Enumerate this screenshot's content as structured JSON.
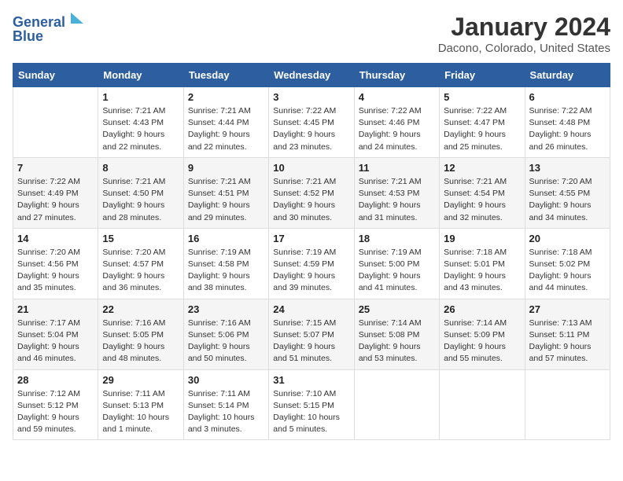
{
  "logo": {
    "line1": "General",
    "line2": "Blue"
  },
  "title": "January 2024",
  "subtitle": "Dacono, Colorado, United States",
  "days_of_week": [
    "Sunday",
    "Monday",
    "Tuesday",
    "Wednesday",
    "Thursday",
    "Friday",
    "Saturday"
  ],
  "weeks": [
    [
      {
        "day": "",
        "info": ""
      },
      {
        "day": "1",
        "info": "Sunrise: 7:21 AM\nSunset: 4:43 PM\nDaylight: 9 hours\nand 22 minutes."
      },
      {
        "day": "2",
        "info": "Sunrise: 7:21 AM\nSunset: 4:44 PM\nDaylight: 9 hours\nand 22 minutes."
      },
      {
        "day": "3",
        "info": "Sunrise: 7:22 AM\nSunset: 4:45 PM\nDaylight: 9 hours\nand 23 minutes."
      },
      {
        "day": "4",
        "info": "Sunrise: 7:22 AM\nSunset: 4:46 PM\nDaylight: 9 hours\nand 24 minutes."
      },
      {
        "day": "5",
        "info": "Sunrise: 7:22 AM\nSunset: 4:47 PM\nDaylight: 9 hours\nand 25 minutes."
      },
      {
        "day": "6",
        "info": "Sunrise: 7:22 AM\nSunset: 4:48 PM\nDaylight: 9 hours\nand 26 minutes."
      }
    ],
    [
      {
        "day": "7",
        "info": "Sunrise: 7:22 AM\nSunset: 4:49 PM\nDaylight: 9 hours\nand 27 minutes."
      },
      {
        "day": "8",
        "info": "Sunrise: 7:21 AM\nSunset: 4:50 PM\nDaylight: 9 hours\nand 28 minutes."
      },
      {
        "day": "9",
        "info": "Sunrise: 7:21 AM\nSunset: 4:51 PM\nDaylight: 9 hours\nand 29 minutes."
      },
      {
        "day": "10",
        "info": "Sunrise: 7:21 AM\nSunset: 4:52 PM\nDaylight: 9 hours\nand 30 minutes."
      },
      {
        "day": "11",
        "info": "Sunrise: 7:21 AM\nSunset: 4:53 PM\nDaylight: 9 hours\nand 31 minutes."
      },
      {
        "day": "12",
        "info": "Sunrise: 7:21 AM\nSunset: 4:54 PM\nDaylight: 9 hours\nand 32 minutes."
      },
      {
        "day": "13",
        "info": "Sunrise: 7:20 AM\nSunset: 4:55 PM\nDaylight: 9 hours\nand 34 minutes."
      }
    ],
    [
      {
        "day": "14",
        "info": "Sunrise: 7:20 AM\nSunset: 4:56 PM\nDaylight: 9 hours\nand 35 minutes."
      },
      {
        "day": "15",
        "info": "Sunrise: 7:20 AM\nSunset: 4:57 PM\nDaylight: 9 hours\nand 36 minutes."
      },
      {
        "day": "16",
        "info": "Sunrise: 7:19 AM\nSunset: 4:58 PM\nDaylight: 9 hours\nand 38 minutes."
      },
      {
        "day": "17",
        "info": "Sunrise: 7:19 AM\nSunset: 4:59 PM\nDaylight: 9 hours\nand 39 minutes."
      },
      {
        "day": "18",
        "info": "Sunrise: 7:19 AM\nSunset: 5:00 PM\nDaylight: 9 hours\nand 41 minutes."
      },
      {
        "day": "19",
        "info": "Sunrise: 7:18 AM\nSunset: 5:01 PM\nDaylight: 9 hours\nand 43 minutes."
      },
      {
        "day": "20",
        "info": "Sunrise: 7:18 AM\nSunset: 5:02 PM\nDaylight: 9 hours\nand 44 minutes."
      }
    ],
    [
      {
        "day": "21",
        "info": "Sunrise: 7:17 AM\nSunset: 5:04 PM\nDaylight: 9 hours\nand 46 minutes."
      },
      {
        "day": "22",
        "info": "Sunrise: 7:16 AM\nSunset: 5:05 PM\nDaylight: 9 hours\nand 48 minutes."
      },
      {
        "day": "23",
        "info": "Sunrise: 7:16 AM\nSunset: 5:06 PM\nDaylight: 9 hours\nand 50 minutes."
      },
      {
        "day": "24",
        "info": "Sunrise: 7:15 AM\nSunset: 5:07 PM\nDaylight: 9 hours\nand 51 minutes."
      },
      {
        "day": "25",
        "info": "Sunrise: 7:14 AM\nSunset: 5:08 PM\nDaylight: 9 hours\nand 53 minutes."
      },
      {
        "day": "26",
        "info": "Sunrise: 7:14 AM\nSunset: 5:09 PM\nDaylight: 9 hours\nand 55 minutes."
      },
      {
        "day": "27",
        "info": "Sunrise: 7:13 AM\nSunset: 5:11 PM\nDaylight: 9 hours\nand 57 minutes."
      }
    ],
    [
      {
        "day": "28",
        "info": "Sunrise: 7:12 AM\nSunset: 5:12 PM\nDaylight: 9 hours\nand 59 minutes."
      },
      {
        "day": "29",
        "info": "Sunrise: 7:11 AM\nSunset: 5:13 PM\nDaylight: 10 hours\nand 1 minute."
      },
      {
        "day": "30",
        "info": "Sunrise: 7:11 AM\nSunset: 5:14 PM\nDaylight: 10 hours\nand 3 minutes."
      },
      {
        "day": "31",
        "info": "Sunrise: 7:10 AM\nSunset: 5:15 PM\nDaylight: 10 hours\nand 5 minutes."
      },
      {
        "day": "",
        "info": ""
      },
      {
        "day": "",
        "info": ""
      },
      {
        "day": "",
        "info": ""
      }
    ]
  ]
}
